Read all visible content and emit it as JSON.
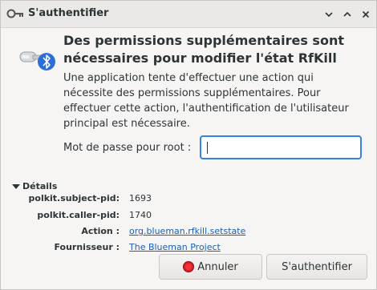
{
  "window": {
    "title": "S'authentifier",
    "icons": {
      "app": "key-icon",
      "minimize": "chevron-down-icon",
      "maximize": "chevron-up-icon",
      "close": "close-icon"
    }
  },
  "dialog": {
    "icon": "key-bluetooth-icon",
    "heading": "Des permissions supplémentaires sont nécessaires pour modifier l'état RfKill",
    "description": "Une application tente d'effectuer une action qui nécessite des permissions supplémentaires. Pour effectuer cette action, l'authentification de l'utilisateur principal est nécessaire.",
    "password_label": "Mot de passe pour root :",
    "password_value": ""
  },
  "details": {
    "toggle_label": "Détails",
    "rows": [
      {
        "label": "polkit.subject-pid:",
        "value": "1693"
      },
      {
        "label": "polkit.caller-pid:",
        "value": "1740"
      },
      {
        "label": "Action :",
        "value": "org.blueman.rfkill.setstate"
      },
      {
        "label": "Fournisseur :",
        "value": "The Blueman Project"
      }
    ]
  },
  "buttons": {
    "cancel": "Annuler",
    "cancel_icon": "stop-icon",
    "authenticate": "S'authentifier"
  },
  "colors": {
    "accent": "#3584e4",
    "link": "#1a5fb4",
    "stop": "#e01b24"
  }
}
